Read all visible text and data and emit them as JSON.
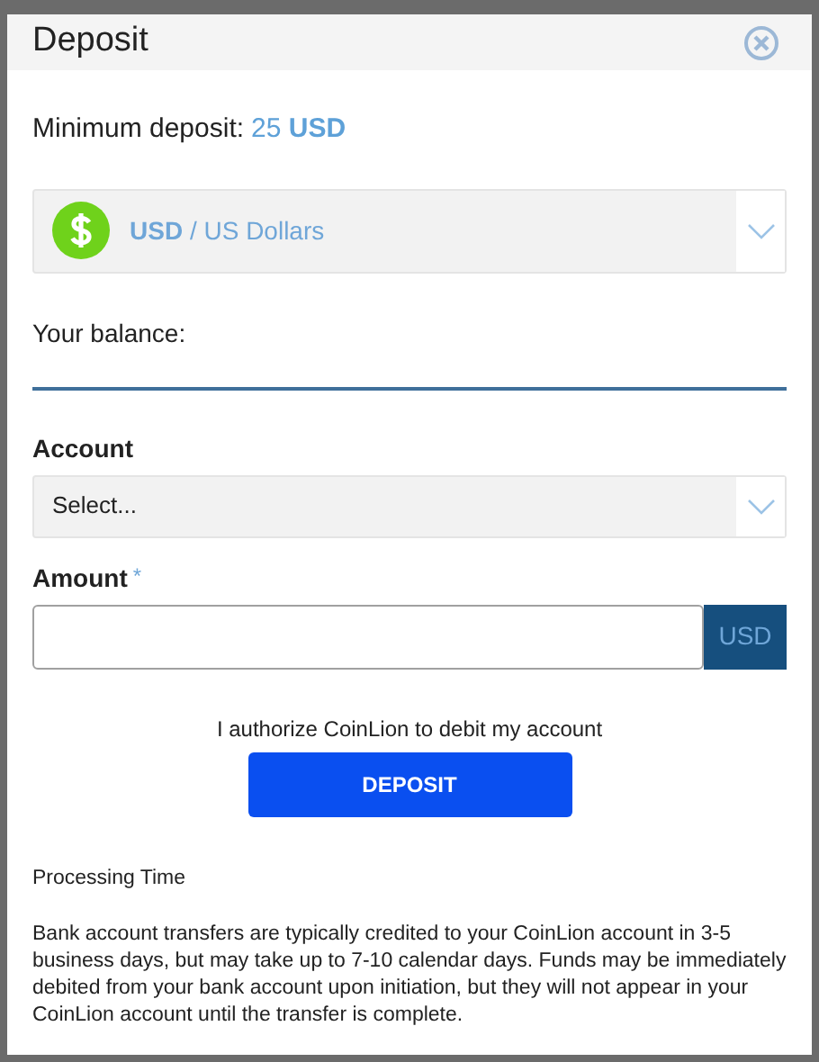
{
  "dialog": {
    "title": "Deposit"
  },
  "minimum_deposit": {
    "label": "Minimum deposit:",
    "value": "25 **USD**"
  },
  "currency_select": {
    "value": "**USD** / US Dollars"
  },
  "balance": {
    "label": "Your balance:"
  },
  "account": {
    "label": "Account",
    "placeholder": "Select..."
  },
  "amount": {
    "label": "Amount",
    "required_mark": "*",
    "unit": "USD"
  },
  "authorization": "I authorize CoinLion to debit my account",
  "deposit_button": "DEPOSIT",
  "processing": {
    "title": "Processing Time",
    "text": "Bank account transfers are typically credited to your CoinLion account in 3-5 business days, but may take up to 7-10 calendar days. Funds may be immediately debited from your bank account upon initiation, but they will not appear in your CoinLion account until the transfer is complete."
  }
}
